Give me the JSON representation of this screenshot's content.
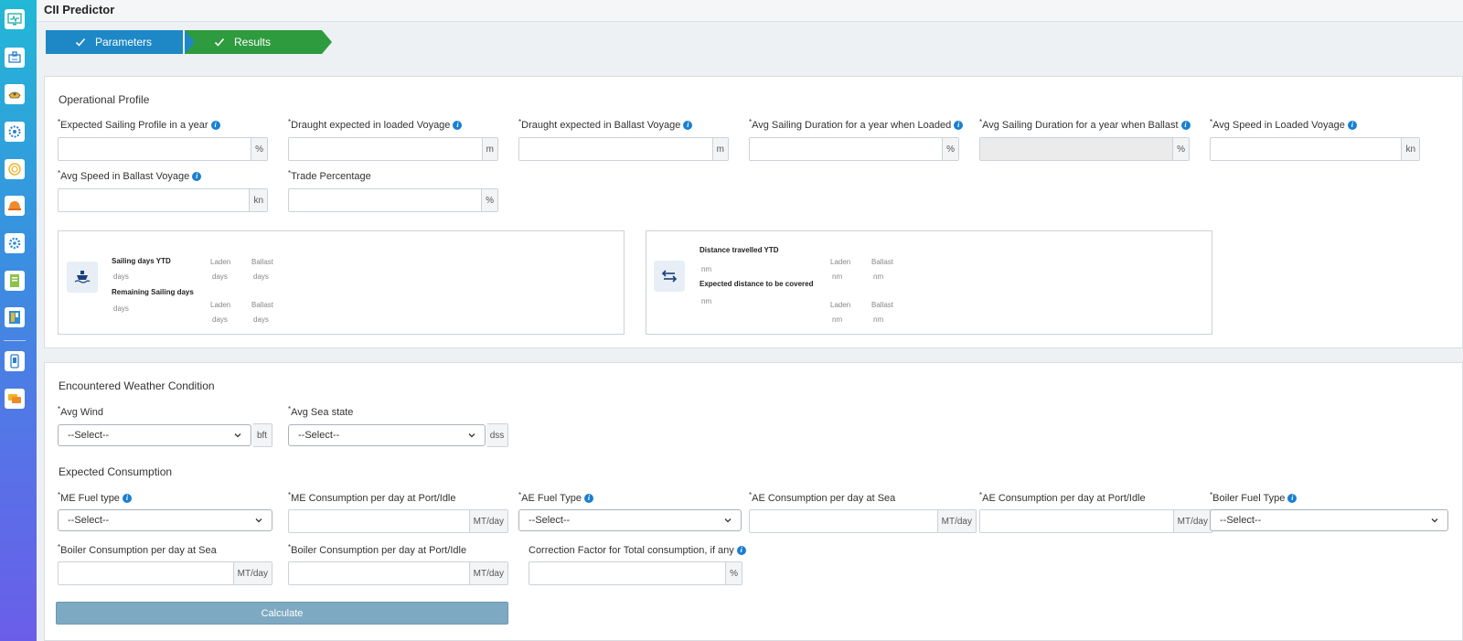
{
  "app": {
    "title": "CII Predictor"
  },
  "sidebar": {
    "icons": [
      "monitor-icon",
      "ship-icon",
      "boat-icon",
      "settings-icon",
      "dial-icon",
      "helmet-icon",
      "gear-icon",
      "book-icon",
      "dashboard-icon",
      "mobile-icon",
      "chat-icon"
    ]
  },
  "wizard": {
    "steps": [
      {
        "label": "Parameters"
      },
      {
        "label": "Results"
      }
    ]
  },
  "operational": {
    "title": "Operational Profile",
    "fields": [
      {
        "label": "Expected Sailing Profile in a year",
        "unit": "%",
        "value": ""
      },
      {
        "label": "Draught expected in loaded Voyage",
        "unit": "m",
        "value": ""
      },
      {
        "label": "Draught expected in Ballast Voyage",
        "unit": "m",
        "value": ""
      },
      {
        "label": "Avg Sailing Duration for a year when Loaded",
        "unit": "%",
        "value": ""
      },
      {
        "label": "Avg Sailing Duration for a year when Ballast",
        "unit": "%",
        "value": ""
      },
      {
        "label": "Avg Speed in Loaded Voyage",
        "unit": "kn",
        "value": ""
      },
      {
        "label": "Avg Speed in Ballast Voyage",
        "unit": "kn",
        "value": ""
      },
      {
        "label": "Trade Percentage",
        "unit": "%",
        "value": ""
      }
    ],
    "sailing": {
      "ytd_label": "Sailing days YTD",
      "remaining_label": "Remaining Sailing days",
      "laden": "Laden",
      "ballast": "Ballast",
      "days": "days"
    },
    "distance": {
      "ytd_label": "Distance travelled YTD",
      "expected_label": "Expected distance to be covered",
      "laden": "Laden",
      "ballast": "Ballast",
      "nm": "nm"
    }
  },
  "weather": {
    "title": "Encountered Weather Condition",
    "avg_wind": {
      "label": "Avg Wind",
      "value": "--Select--",
      "unit": "bft"
    },
    "avg_sea": {
      "label": "Avg Sea state",
      "value": "--Select--",
      "unit": "dss"
    }
  },
  "consumption": {
    "title": "Expected Consumption",
    "me_fuel_type": {
      "label": "ME Fuel type",
      "value": "--Select--"
    },
    "me_port": {
      "label": "ME Consumption per day at Port/Idle",
      "unit": "MT/day",
      "value": ""
    },
    "ae_fuel_type": {
      "label": "AE Fuel Type",
      "value": "--Select--"
    },
    "ae_sea": {
      "label": "AE Consumption per day at Sea",
      "unit": "MT/day",
      "value": ""
    },
    "ae_port": {
      "label": "AE Consumption per day at Port/Idle",
      "unit": "MT/day",
      "value": ""
    },
    "boiler_fuel_type": {
      "label": "Boiler Fuel Type",
      "value": "--Select--"
    },
    "boiler_sea": {
      "label": "Boiler Consumption per day at Sea",
      "unit": "MT/day",
      "value": ""
    },
    "boiler_port": {
      "label": "Boiler Consumption per day at Port/Idle",
      "unit": "MT/day",
      "value": ""
    },
    "correction": {
      "label": "Correction Factor for Total consumption, if any",
      "unit": "%",
      "value": ""
    }
  },
  "actions": {
    "calculate": "Calculate"
  },
  "colors": {
    "primary": "#1e88c7",
    "success": "#2e9b3e",
    "info": "#1a7fd0",
    "button": "#7ea9c2"
  }
}
